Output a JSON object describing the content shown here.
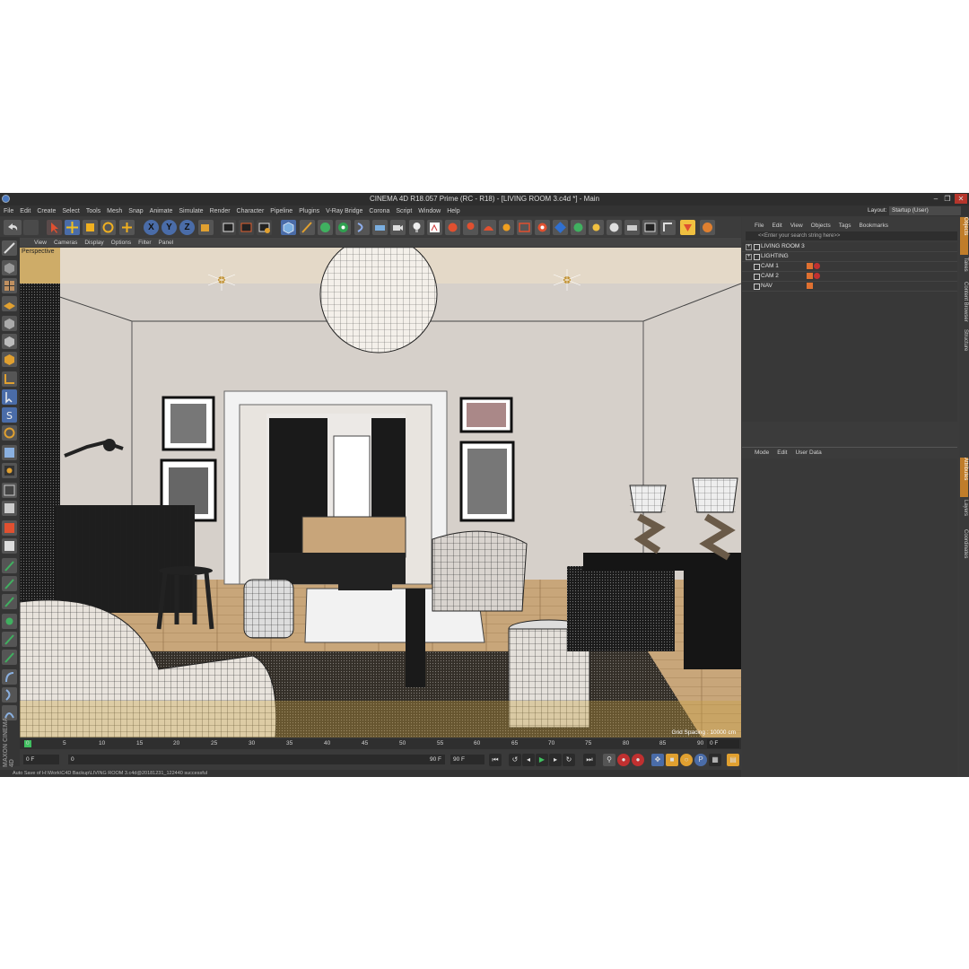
{
  "window": {
    "title": "CINEMA 4D R18.057 Prime (RC - R18) - [LIVING ROOM 3.c4d *] - Main",
    "controls": [
      "–",
      "❐",
      "✕"
    ]
  },
  "menu": [
    "File",
    "Edit",
    "Create",
    "Select",
    "Tools",
    "Mesh",
    "Snap",
    "Animate",
    "Simulate",
    "Render",
    "Character",
    "Pipeline",
    "Plugins",
    "V-Ray Bridge",
    "Corona",
    "Script",
    "Window",
    "Help"
  ],
  "layout": {
    "label": "Layout:",
    "value": "Startup (User)"
  },
  "toolbar": {
    "axis_x": "X",
    "axis_y": "Y",
    "axis_z": "Z"
  },
  "viewport": {
    "menu": [
      "View",
      "Cameras",
      "Display",
      "Options",
      "Filter",
      "Panel"
    ],
    "label": "Perspective",
    "grid_spacing": "Grid Spacing : 10000 cm"
  },
  "timeline": {
    "ticks": [
      "0",
      "5",
      "10",
      "15",
      "20",
      "25",
      "30",
      "35",
      "40",
      "45",
      "50",
      "55",
      "60",
      "65",
      "70",
      "75",
      "80",
      "85",
      "90"
    ],
    "current_frame": "0 F",
    "start": "0 F",
    "start_min": "0",
    "end_preview": "90 F",
    "end": "90 F"
  },
  "status": "Auto Save of H:\\Work\\C4D Backup\\LIVING ROOM 3.c4d@20181231_122440 successful",
  "branding": "MAXON CINEMA 4D",
  "object_manager": {
    "menu": [
      "File",
      "Edit",
      "View",
      "Objects",
      "Tags",
      "Bookmarks"
    ],
    "search_placeholder": "<<Enter your search string here>>",
    "objects": [
      {
        "name": "LIVING ROOM 3",
        "expand": "+",
        "tags": []
      },
      {
        "name": "LIGHTING",
        "expand": "+",
        "tags": []
      },
      {
        "name": "CAM 1",
        "expand": "",
        "tags": [
          "orange",
          "red"
        ]
      },
      {
        "name": "CAM 2",
        "expand": "",
        "tags": [
          "orange",
          "red"
        ]
      },
      {
        "name": "NAV",
        "expand": "",
        "tags": [
          "orange"
        ]
      }
    ]
  },
  "attribute_manager": {
    "menu": [
      "Mode",
      "Edit",
      "User Data"
    ]
  },
  "side_tabs": [
    "Objects",
    "Takes",
    "Content Browser",
    "Structure",
    "Attributes",
    "Layers",
    "Coordinates"
  ],
  "colors": {
    "accent": "#c07d2a",
    "bg": "#3a3a3a",
    "panel": "#3b3b3b"
  }
}
